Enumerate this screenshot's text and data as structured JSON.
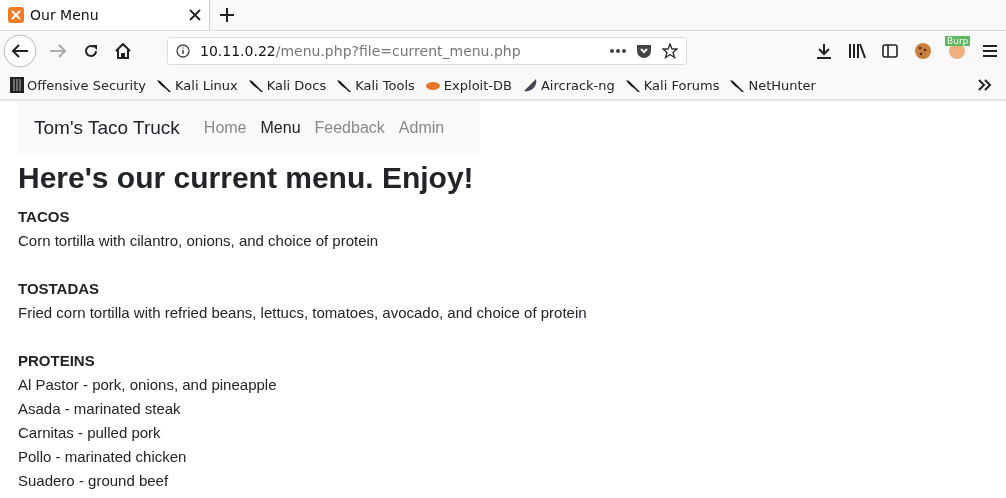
{
  "browser": {
    "tab": {
      "title": "Our Menu",
      "selected": true
    },
    "url": {
      "host": "10.11.0.22",
      "path": "/menu.php?file=current_menu.php"
    },
    "extension_badge": "Burp",
    "bookmarks": [
      {
        "label": "Offensive Security",
        "kind": "offsec"
      },
      {
        "label": "Kali Linux",
        "kind": "kali"
      },
      {
        "label": "Kali Docs",
        "kind": "kali"
      },
      {
        "label": "Kali Tools",
        "kind": "kali"
      },
      {
        "label": "Exploit-DB",
        "kind": "exploit"
      },
      {
        "label": "Aircrack-ng",
        "kind": "aircrack"
      },
      {
        "label": "Kali Forums",
        "kind": "kali"
      },
      {
        "label": "NetHunter",
        "kind": "kali"
      }
    ]
  },
  "navbar": {
    "brand": "Tom's Taco Truck",
    "links": [
      {
        "label": "Home",
        "selected": false
      },
      {
        "label": "Menu",
        "selected": true
      },
      {
        "label": "Feedback",
        "selected": false
      },
      {
        "label": "Admin",
        "selected": false
      }
    ]
  },
  "heading": "Here's our current menu. Enjoy!",
  "sections": [
    {
      "title": "TACOS",
      "lines": [
        "Corn tortilla with cilantro, onions, and choice of protein"
      ]
    },
    {
      "title": "TOSTADAS",
      "lines": [
        "Fried corn tortilla with refried beans, lettucs, tomatoes, avocado, and choice of protein"
      ]
    },
    {
      "title": "PROTEINS",
      "lines": [
        "Al Pastor - pork, onions, and pineapple",
        "Asada - marinated steak",
        "Carnitas - pulled pork",
        "Pollo - marinated chicken",
        "Suadero - ground beef"
      ]
    }
  ]
}
